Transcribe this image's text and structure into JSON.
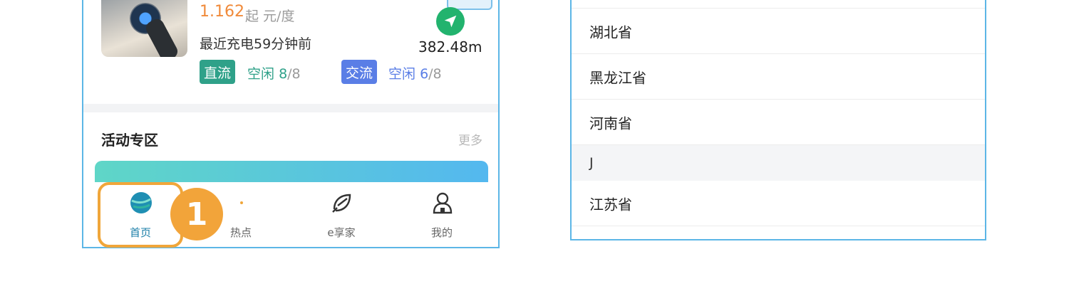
{
  "station": {
    "price": "1.162",
    "price_unit": "起 元/度",
    "last_charge": "最近充电59分钟前",
    "distance": "382.48m",
    "dc_tag": "直流",
    "dc_status": "空闲",
    "dc_free": "8",
    "dc_total": "/8",
    "ac_tag": "交流",
    "ac_status": "空闲",
    "ac_free": "6",
    "ac_total": "/8"
  },
  "activity": {
    "title": "活动专区",
    "more": "更多"
  },
  "tabbar": {
    "items": [
      {
        "label": "首页",
        "icon": "globe-icon"
      },
      {
        "label": "热点",
        "icon": "hotspot-icon"
      },
      {
        "label": "e享家",
        "icon": "leaf-icon"
      },
      {
        "label": "我的",
        "icon": "user-icon"
      }
    ]
  },
  "annotation": {
    "step": "1"
  },
  "provinces": {
    "rows": [
      {
        "label": "湖北省"
      },
      {
        "label": "黑龙江省"
      },
      {
        "label": "河南省"
      }
    ],
    "index_letter": "J",
    "rows_after": [
      {
        "label": "江苏省"
      }
    ]
  },
  "colors": {
    "accent_blue": "#5cb6e6",
    "price_orange": "#f08a3a",
    "dc_green": "#2fa189",
    "ac_blue": "#5a7ee6",
    "nav_green": "#22b36e",
    "highlight_orange": "#f0a63a"
  }
}
